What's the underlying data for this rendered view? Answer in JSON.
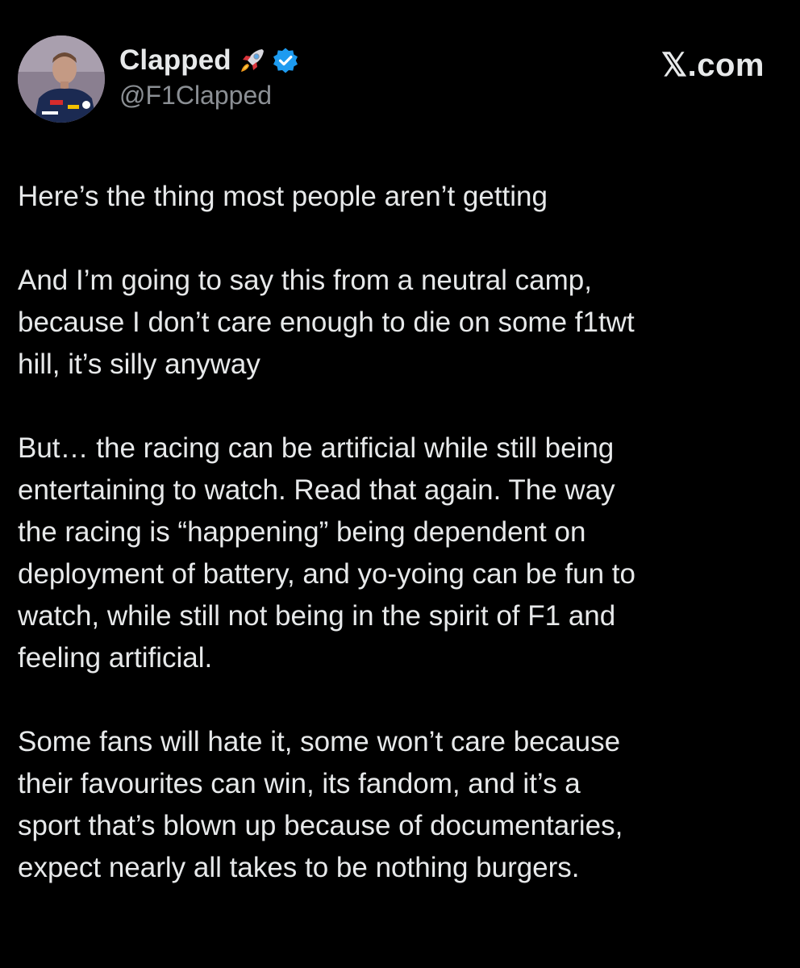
{
  "tweet": {
    "author": {
      "display_name": "Clapped",
      "name_emoji": "rocket-emoji",
      "verified_badge": "verified-badge-icon",
      "handle": "@F1Clapped",
      "avatar": "driver-photo-avatar"
    },
    "brand": "𝕏.com",
    "paragraphs": [
      "Here’s the thing most people aren’t getting",
      "And I’m going to say this from a neutral camp,\nbecause I don’t care enough to die on some f1twt\nhill, it’s silly anyway",
      "But… the racing can be artificial while still being\nentertaining to watch.  Read that again. The way\nthe racing is “happening” being dependent on\ndeployment of battery, and yo-yoing can be fun to\nwatch, while still not being in the spirit of F1 and\nfeeling artificial.",
      "Some fans will hate it, some won’t care because\ntheir favourites can win, its fandom, and it’s a\nsport that’s blown up because of documentaries,\nexpect nearly all takes to be nothing burgers."
    ]
  },
  "colors": {
    "background": "#000000",
    "text_primary": "#e7e9ea",
    "text_secondary": "#8b8f94",
    "verified_blue": "#1d9bf0"
  }
}
